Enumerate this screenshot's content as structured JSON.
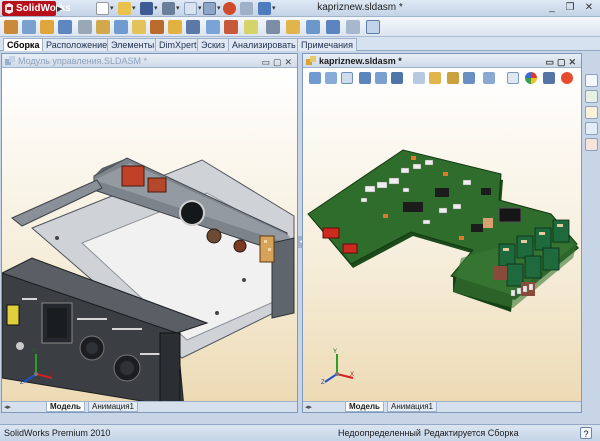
{
  "app": {
    "logo_text": "SolidWorks",
    "document_title": "kapriznew.sldasm *",
    "window_buttons": [
      "_",
      "❐",
      "✕"
    ]
  },
  "tabs": [
    {
      "label": "Сборка",
      "active": true
    },
    {
      "label": "Расположение",
      "active": false
    },
    {
      "label": "Элементы",
      "active": false
    },
    {
      "label": "DimXpert",
      "active": false
    },
    {
      "label": "Эскиз",
      "active": false
    },
    {
      "label": "Анализировать",
      "active": false
    },
    {
      "label": "Примечания",
      "active": false
    }
  ],
  "left_panel": {
    "title": "Модуль управления.SLDASM *",
    "bottom_tabs": [
      "Модель",
      "Анимация1"
    ]
  },
  "right_panel": {
    "title": "kapriznew.sldasm *",
    "bottom_tabs": [
      "Модель",
      "Анимация1"
    ]
  },
  "axes": {
    "x": "X",
    "y": "Y",
    "z": "Z"
  },
  "statusbar": {
    "product": "SolidWorks Premium 2010",
    "state": "Недоопределенный",
    "mode": "Редактируется Сборка",
    "help": "?"
  },
  "colors": {
    "accent": "#b8101b",
    "pcb_green": "#2f6d2c",
    "panel_border": "#7f98bb"
  }
}
